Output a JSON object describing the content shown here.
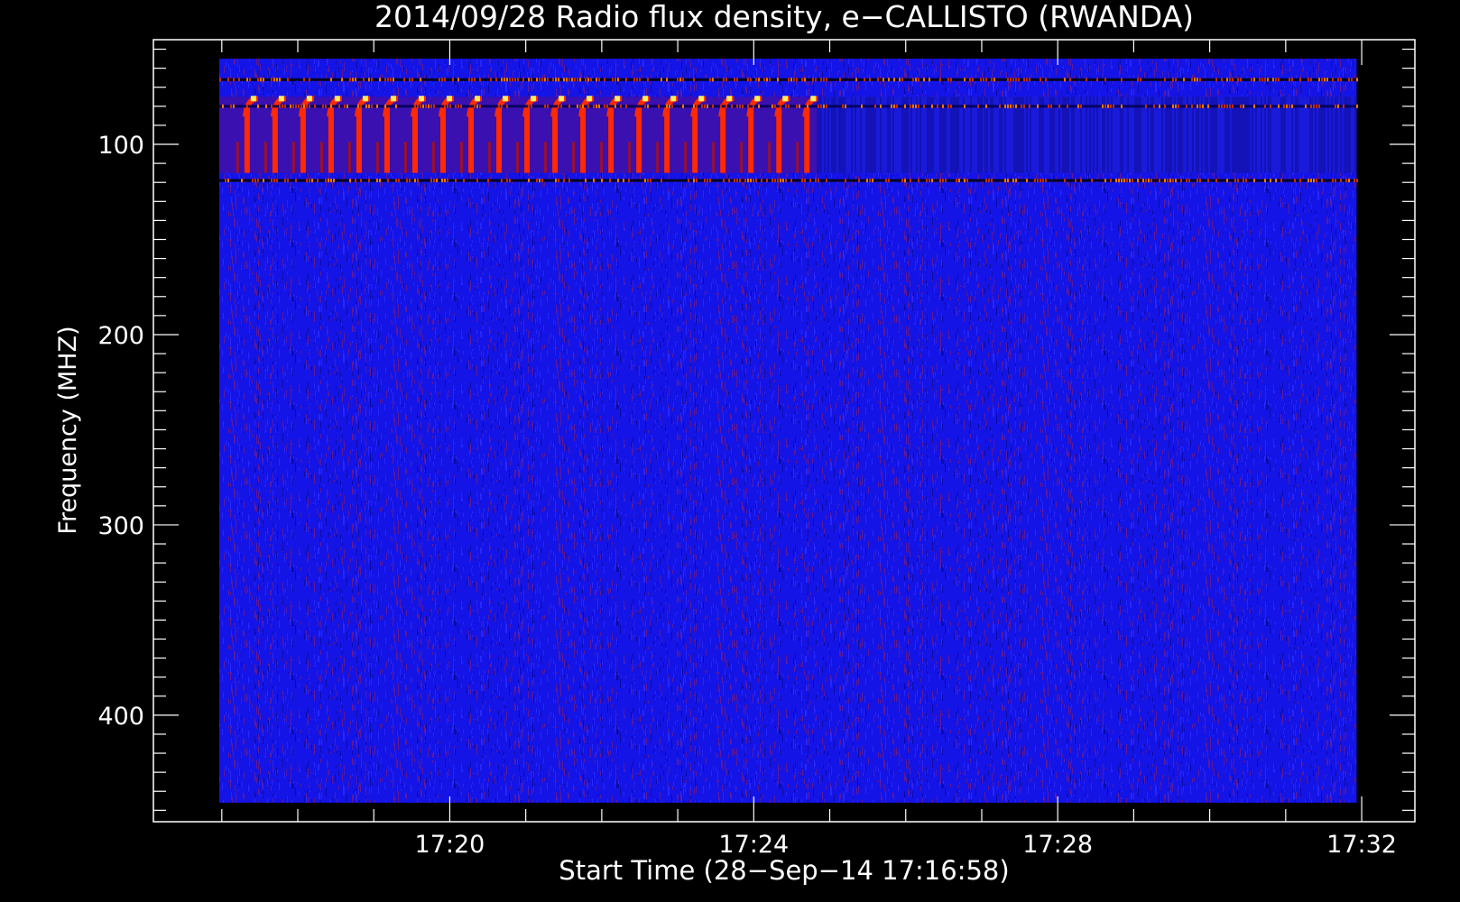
{
  "chart_data": {
    "type": "heatmap",
    "title": "2014/09/28  Radio flux density, e−CALLISTO (RWANDA)",
    "xlabel": "Start Time (28−Sep−14 17:16:58)",
    "ylabel": "Frequency (MHZ)",
    "x_axis": {
      "unit": "time",
      "range": [
        "17:16:06",
        "17:32:42"
      ],
      "data_range": [
        "17:16:58",
        "17:31:56"
      ],
      "major_ticks": [
        "17:20",
        "17:24",
        "17:28",
        "17:32"
      ],
      "minor_tick_interval_minutes": 1
    },
    "y_axis": {
      "unit": "MHz",
      "range": [
        45,
        456
      ],
      "data_range": [
        55,
        446
      ],
      "inverted": true,
      "major_ticks": [
        100,
        200,
        300,
        400
      ],
      "minor_tick_interval": 10
    },
    "features": {
      "background_color": "#1414e6",
      "noise_color": "#6a1a8a",
      "burst_color": "#ff2a00",
      "burst_core_color": "#ffee66",
      "persistent_band_lines_mhz": [
        66,
        80,
        119
      ],
      "strong_band_mhz": [
        75,
        115
      ],
      "strong_band_end": "17:24:50",
      "periodic_bursts": {
        "count": 21,
        "start": "17:17:20",
        "end": "17:24:42",
        "freq_range_mhz": [
          75,
          115
        ]
      }
    },
    "grid": false,
    "legend": "none"
  }
}
